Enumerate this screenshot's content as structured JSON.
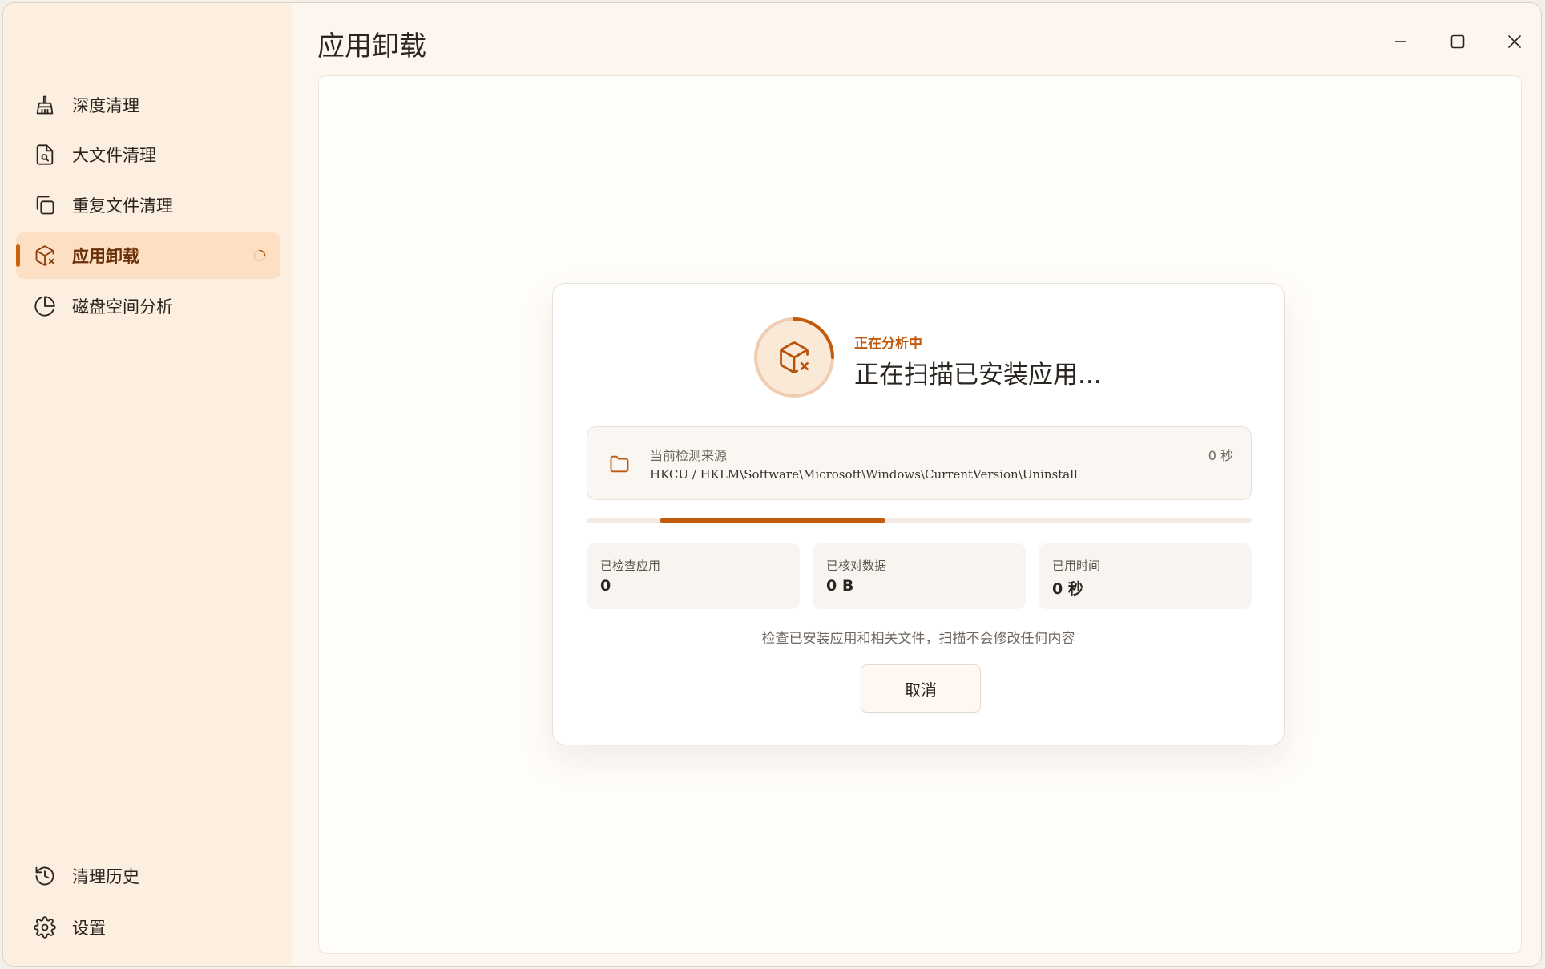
{
  "app": {
    "title": "应用卸载"
  },
  "window_controls": {
    "minimize_icon": "minimize-icon",
    "maximize_icon": "maximize-icon",
    "close_icon": "close-icon"
  },
  "sidebar": {
    "items": [
      {
        "label": "深度清理",
        "icon": "broom-icon"
      },
      {
        "label": "大文件清理",
        "icon": "file-search-icon"
      },
      {
        "label": "重复文件清理",
        "icon": "copy-icon"
      },
      {
        "label": "应用卸载",
        "icon": "package-x-icon",
        "active": true
      },
      {
        "label": "磁盘空间分析",
        "icon": "pie-chart-icon"
      }
    ],
    "bottom_items": [
      {
        "label": "清理历史",
        "icon": "history-icon"
      },
      {
        "label": "设置",
        "icon": "gear-icon"
      }
    ]
  },
  "scan": {
    "status_small": "正在分析中",
    "status_big": "正在扫描已安装应用...",
    "source_label": "当前检测来源",
    "source_path": "HKCU / HKLM\\Software\\Microsoft\\Windows\\CurrentVersion\\Uninstall",
    "source_time": "0 秒",
    "progress_fraction": 0.34,
    "stats": [
      {
        "label": "已检查应用",
        "value": "0"
      },
      {
        "label": "已核对数据",
        "value": "0 B"
      },
      {
        "label": "已用时间",
        "value": "0 秒"
      }
    ],
    "note": "检查已安装应用和相关文件，扫描不会修改任何内容",
    "cancel_label": "取消"
  },
  "colors": {
    "accent": "#c25a0c",
    "sidebar_bg": "#fdefe0",
    "active_bg": "#fde0c4"
  }
}
